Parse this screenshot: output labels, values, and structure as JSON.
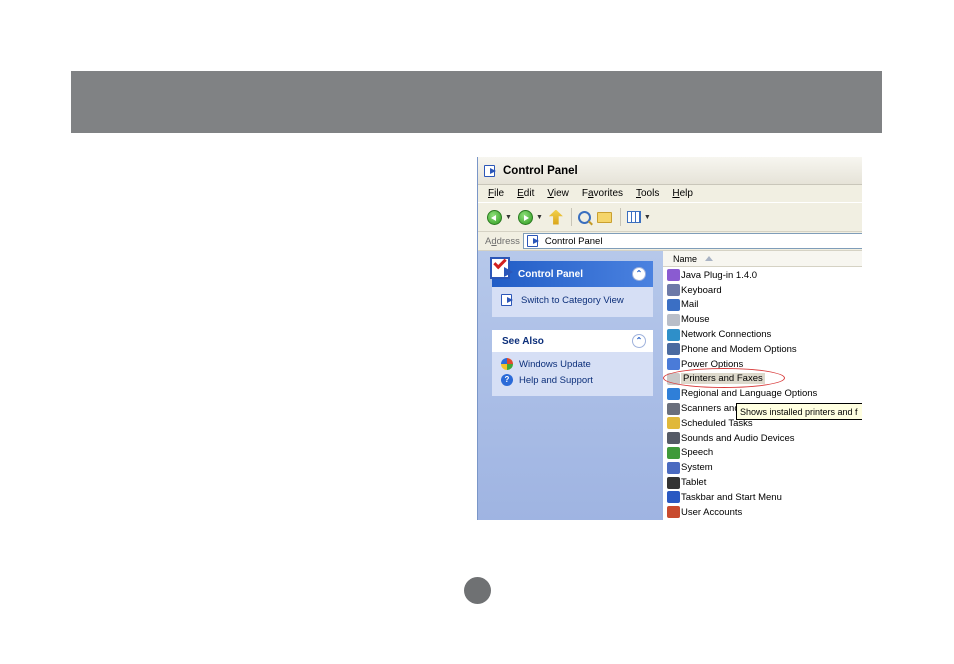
{
  "window": {
    "title": "Control Panel"
  },
  "menu": {
    "items": [
      {
        "key": "F",
        "rest": "ile"
      },
      {
        "key": "E",
        "rest": "dit"
      },
      {
        "key": "V",
        "rest": "iew"
      },
      {
        "pre": "F",
        "key": "a",
        "rest": "vorites"
      },
      {
        "key": "T",
        "rest": "ools"
      },
      {
        "key": "H",
        "rest": "elp"
      }
    ]
  },
  "toolbar": {
    "back": "back-icon",
    "forward": "forward-icon",
    "up": "up-folder-icon",
    "search": "search-icon",
    "folders": "folders-icon",
    "views": "views-icon"
  },
  "address": {
    "label_pre": "A",
    "label_key": "d",
    "label_rest": "dress",
    "value": "Control Panel"
  },
  "left_pane": {
    "control_panel_box": {
      "title": "Control Panel",
      "items": [
        {
          "label": "Switch to Category View"
        }
      ]
    },
    "see_also_box": {
      "title": "See Also",
      "items": [
        {
          "label": "Windows Update"
        },
        {
          "label": "Help and Support"
        }
      ]
    }
  },
  "list": {
    "column_header": "Name",
    "items": [
      {
        "label": "Java Plug-in 1.4.0",
        "color": "#8a5bd1"
      },
      {
        "label": "Keyboard",
        "color": "#6d7aa8"
      },
      {
        "label": "Mail",
        "color": "#3b6fc4"
      },
      {
        "label": "Mouse",
        "color": "#b9bec8"
      },
      {
        "label": "Network Connections",
        "color": "#2e8fc9"
      },
      {
        "label": "Phone and Modem Options",
        "color": "#4a6aa0"
      },
      {
        "label": "Power Options",
        "color": "#4a7bd8"
      },
      {
        "label": "Printers and Faxes",
        "color": "#c8c8c8"
      },
      {
        "label": "Regional and Language Options",
        "color": "#2f7fd8"
      },
      {
        "label": "Scanners and",
        "color": "#6a6f7c"
      },
      {
        "label": "Scheduled Tasks",
        "color": "#e0b83a"
      },
      {
        "label": "Sounds and Audio Devices",
        "color": "#555a66"
      },
      {
        "label": "Speech",
        "color": "#3f9a3a"
      },
      {
        "label": "System",
        "color": "#4a6ac0"
      },
      {
        "label": "Tablet",
        "color": "#333333"
      },
      {
        "label": "Taskbar and Start Menu",
        "color": "#2a58c2"
      },
      {
        "label": "User Accounts",
        "color": "#c84a2e"
      }
    ],
    "highlighted": "Printers and Faxes"
  },
  "tooltip": {
    "text": "Shows installed printers and f"
  }
}
